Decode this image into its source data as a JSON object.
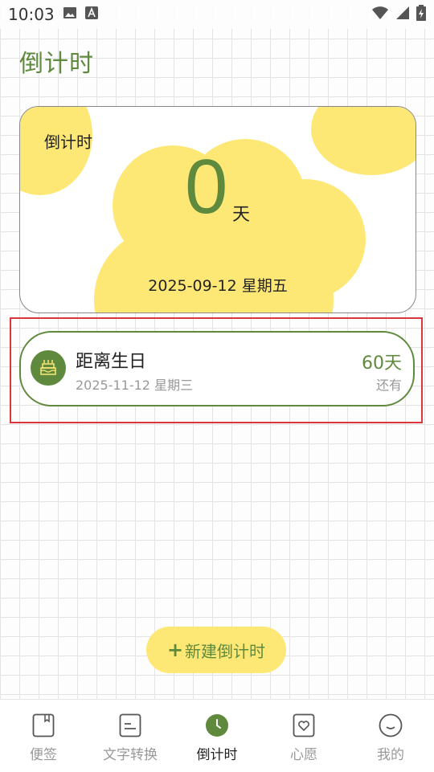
{
  "status_bar": {
    "time": "10:03",
    "left_icons": [
      "image-icon",
      "font-a-icon"
    ],
    "right_icons": [
      "wifi-icon",
      "signal-icon",
      "battery-charging-icon"
    ]
  },
  "page": {
    "title": "倒计时"
  },
  "hero": {
    "label": "倒计时",
    "number": "0",
    "unit": "天",
    "date": "2025-09-12 星期五"
  },
  "event": {
    "icon": "birthday-cake-icon",
    "title": "距离生日",
    "date": "2025-11-12 星期三",
    "days": "60天",
    "sub": "还有"
  },
  "fab": {
    "plus": "+",
    "label": "新建倒计时"
  },
  "bottom_nav": {
    "items": [
      {
        "label": "便签",
        "icon": "note-icon"
      },
      {
        "label": "文字转换",
        "icon": "text-convert-icon"
      },
      {
        "label": "倒计时",
        "icon": "clock-icon"
      },
      {
        "label": "心愿",
        "icon": "heart-icon"
      },
      {
        "label": "我的",
        "icon": "smiley-icon"
      }
    ],
    "active_index": 2
  },
  "colors": {
    "accent": "#5f8a3e",
    "yellow": "#fde876",
    "highlight_red": "#d9373c"
  }
}
